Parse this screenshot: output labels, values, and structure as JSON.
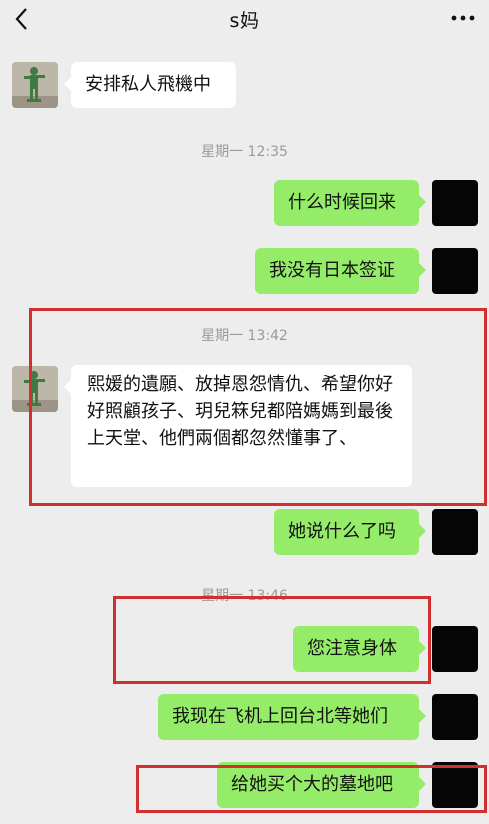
{
  "header": {
    "title": "s妈",
    "back_icon": "chevron-left-icon",
    "more_icon": "more-dots-icon"
  },
  "messages": [
    {
      "side": "left",
      "text": "安排私人飛機中"
    },
    {
      "side": "right",
      "text": "什么时候回来"
    },
    {
      "side": "right",
      "text": "我没有日本签证"
    },
    {
      "side": "left",
      "text": "熙媛的遺願、放掉恩怨情仇、希望你好好照顧孩子、玥兒箖兒都陪媽媽到最後上天堂、他們兩個都忽然懂事了、"
    },
    {
      "side": "right",
      "text": "她说什么了吗"
    },
    {
      "side": "right",
      "text": "您注意身体"
    },
    {
      "side": "right",
      "text": "我现在飞机上回台北等她们"
    },
    {
      "side": "right",
      "text": "给她买个大的墓地吧"
    }
  ],
  "timestamps": [
    "星期一 12:35",
    "星期一 13:42",
    "星期一 13:46"
  ],
  "colors": {
    "background": "#ededed",
    "sent_bubble": "#95ec69",
    "received_bubble": "#ffffff",
    "highlight_box": "#d32f2f"
  }
}
